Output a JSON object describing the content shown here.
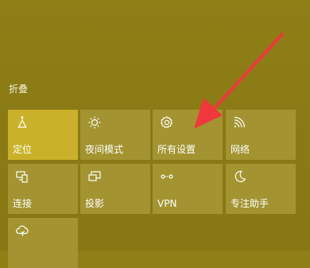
{
  "action_center": {
    "collapse_label": "折叠",
    "tiles": [
      {
        "label": "定位",
        "icon": "location-icon",
        "state": "on"
      },
      {
        "label": "夜间模式",
        "icon": "brightness-icon",
        "state": "off"
      },
      {
        "label": "所有设置",
        "icon": "gear-icon",
        "state": "off"
      },
      {
        "label": "网络",
        "icon": "network-icon",
        "state": "off"
      },
      {
        "label": "连接",
        "icon": "connect-icon",
        "state": "off"
      },
      {
        "label": "投影",
        "icon": "project-icon",
        "state": "off"
      },
      {
        "label": "VPN",
        "icon": "vpn-icon",
        "state": "off"
      },
      {
        "label": "专注助手",
        "icon": "moon-icon",
        "state": "off"
      },
      {
        "label": "",
        "icon": "cloud-sync-icon",
        "state": "off"
      }
    ]
  },
  "annotation": {
    "arrow_color": "#f0383c"
  },
  "colors": {
    "background": "#8f7f16",
    "tile": "#a39431",
    "tile_active": "#c9b229"
  }
}
